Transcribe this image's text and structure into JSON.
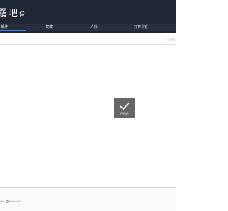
{
  "header": {
    "logo_text": "霧吧"
  },
  "tabs": [
    {
      "label": "邮件"
    },
    {
      "label": "藏藏"
    },
    {
      "label": "人脉"
    },
    {
      "label": "打算作者"
    }
  ],
  "util_text": "三方动态",
  "toast": {
    "message": "已保存"
  },
  "footer": {
    "left_text": "idd",
    "option_label": "Asro dTG"
  }
}
